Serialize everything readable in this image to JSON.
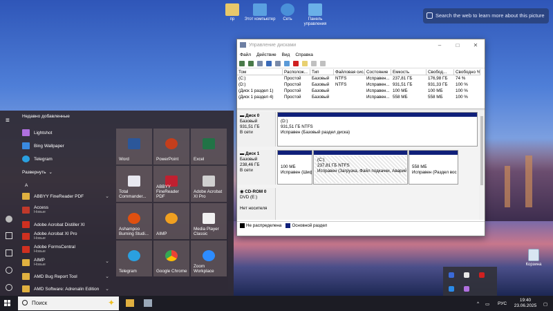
{
  "desktop": {
    "icons": [
      {
        "label": "пр",
        "color": "#e8c86a"
      },
      {
        "label": "Этот компьютер",
        "color": "#5aa0e0"
      },
      {
        "label": "Сеть",
        "color": "#4a90d8"
      },
      {
        "label": "Панель управления",
        "color": "#6ab0e8"
      }
    ],
    "search_web": "Search the web to learn more about this picture",
    "recycle_bin": "Корзина"
  },
  "window": {
    "title": "Управление дисками",
    "menu": [
      "Файл",
      "Действие",
      "Вид",
      "Справка"
    ],
    "columns": [
      "Том",
      "Располож...",
      "Тип",
      "Файловая сис...",
      "Состояние",
      "Емкость",
      "Свобод...",
      "Свободно %"
    ],
    "volumes": [
      [
        "(C:)",
        "Простой",
        "Базовый",
        "NTFS",
        "Исправен...",
        "237,81 ГБ",
        "176,98 ГБ",
        "74 %"
      ],
      [
        "(D:)",
        "Простой",
        "Базовый",
        "NTFS",
        "Исправен...",
        "931,51 ГБ",
        "931,33 ГБ",
        "100 %"
      ],
      [
        "(Диск 1 раздел 1)",
        "Простой",
        "Базовый",
        "",
        "Исправен...",
        "100 МБ",
        "100 МБ",
        "100 %"
      ],
      [
        "(Диск 1 раздел 4)",
        "Простой",
        "Базовый",
        "",
        "Исправен...",
        "558 МБ",
        "558 МБ",
        "100 %"
      ]
    ],
    "disk0": {
      "name": "Диск 0",
      "type": "Базовый",
      "size": "931,51 ГБ",
      "state": "В сети",
      "part_name": "(D:)",
      "part_size": "931,51 ГБ NTFS",
      "part_status": "Исправен (Базовый раздел диска)"
    },
    "disk1": {
      "name": "Диск 1",
      "type": "Базовый",
      "size": "238,46 ГБ",
      "state": "В сети",
      "p1_size": "100 МБ",
      "p1_status": "Исправен (Шиф",
      "p2_name": "(C:)",
      "p2_size": "237,81 ГБ NTFS",
      "p2_status": "Исправен (Загрузка, Файл подкачки, Аварийн",
      "p3_size": "558 МБ",
      "p3_status": "Исправен (Раздел вос"
    },
    "cdrom": {
      "name": "CD-ROM 0",
      "type": "DVD (E:)",
      "media": "Нет носителя"
    },
    "legend": {
      "unallocated": "Не распределена",
      "primary": "Основной раздел"
    }
  },
  "start_menu": {
    "recent_header": "Недавно добавленные",
    "recent": [
      {
        "name": "Lightshot",
        "color": "#b070e0"
      },
      {
        "name": "Bing Wallpaper",
        "color": "#3a8ae0"
      },
      {
        "name": "Telegram",
        "color": "#2aa0e0"
      }
    ],
    "expand": "Развернуть",
    "letter": "A",
    "apps": [
      {
        "name": "ABBYY FineReader PDF",
        "sub": "",
        "color": "#e0b040",
        "chev": "⌄"
      },
      {
        "name": "Access",
        "sub": "Новые",
        "color": "#c0392b",
        "chev": ""
      },
      {
        "name": "Adobe Acrobat Distiller XI",
        "sub": "",
        "color": "#d03020",
        "chev": ""
      },
      {
        "name": "Adobe Acrobat XI Pro",
        "sub": "Новые",
        "color": "#d03020",
        "chev": ""
      },
      {
        "name": "Adobe FormsCentral",
        "sub": "Новые",
        "color": "#d03020",
        "chev": ""
      },
      {
        "name": "AIMP",
        "sub": "Новые",
        "color": "#e0b040",
        "chev": "⌄"
      },
      {
        "name": "AMD Bug Report Tool",
        "sub": "",
        "color": "#e0b040",
        "chev": "⌄"
      },
      {
        "name": "AMD Software: Adrenalin Edition",
        "sub": "",
        "color": "#e0b040",
        "chev": "⌄"
      }
    ],
    "tiles": [
      {
        "label": "Word",
        "color": "#2b579a"
      },
      {
        "label": "PowerPoint",
        "color": "#c43e1c"
      },
      {
        "label": "Excel",
        "color": "#217346"
      },
      {
        "label": "Total Commander...",
        "color": "#e8e8f0"
      },
      {
        "label": "ABBYY FineReader PDF",
        "color": "#c02030"
      },
      {
        "label": "Adobe Acrobat XI Pro",
        "color": "#d0d0d0"
      },
      {
        "label": "Ashampoo Burning Studi...",
        "color": "#e05010"
      },
      {
        "label": "AIMP",
        "color": "#f0a020"
      },
      {
        "label": "Media Player Classic",
        "color": "#f0f0f0"
      },
      {
        "label": "Telegram",
        "color": "#2aa0e0"
      },
      {
        "label": "Google Chrome",
        "color": "#34a853"
      },
      {
        "label": "Zoom Workplace",
        "color": "#2d8cff"
      }
    ]
  },
  "taskbar": {
    "search": "Поиск",
    "lang": "РУС",
    "time": "19:40",
    "date": "23.06.2025"
  }
}
